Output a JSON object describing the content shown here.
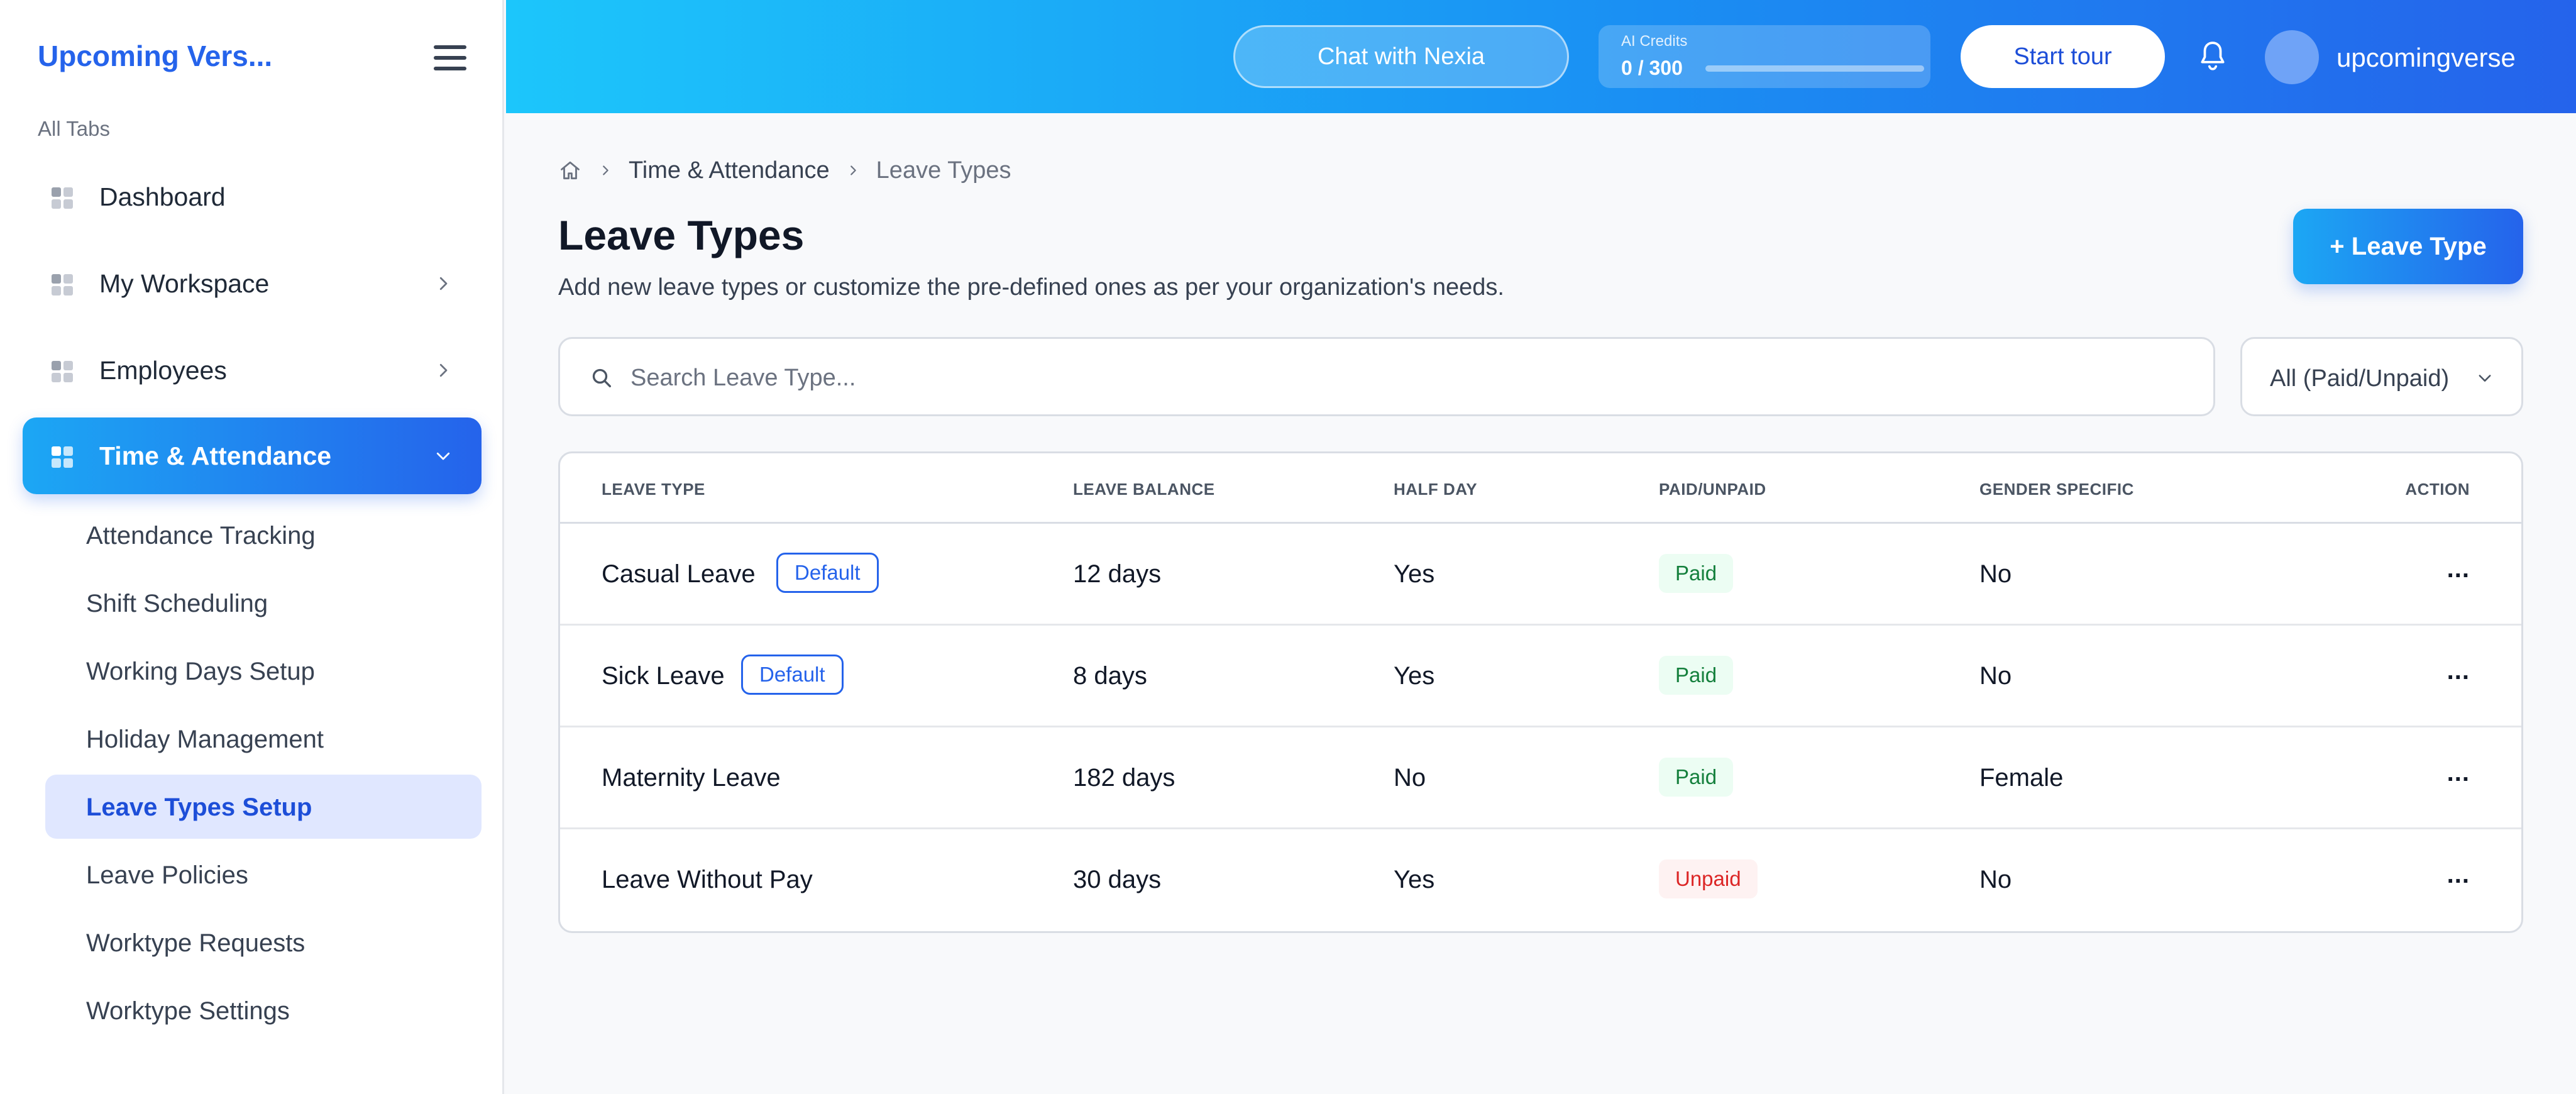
{
  "app": {
    "brand": "Upcoming Vers...",
    "menu_icon": "hamburger-icon"
  },
  "sidebar": {
    "section_label": "All Tabs",
    "nav": [
      {
        "label": "Dashboard",
        "icon": "grid-icon",
        "has_chevron": false
      },
      {
        "label": "My Workspace",
        "icon": "grid-icon",
        "has_chevron": true
      },
      {
        "label": "Employees",
        "icon": "grid-icon",
        "has_chevron": true
      },
      {
        "label": "Time & Attendance",
        "icon": "grid-icon",
        "active": true,
        "expanded": true
      }
    ],
    "sub_items": [
      {
        "label": "Attendance Tracking"
      },
      {
        "label": "Shift Scheduling"
      },
      {
        "label": "Working Days Setup"
      },
      {
        "label": "Holiday Management"
      },
      {
        "label": "Leave Types Setup",
        "active": true
      },
      {
        "label": "Leave Policies"
      },
      {
        "label": "Worktype Requests"
      },
      {
        "label": "Worktype Settings"
      }
    ]
  },
  "header": {
    "chat_label": "Chat with Nexia",
    "credits_label": "AI Credits",
    "credits_value": "0 / 300",
    "credits_fraction": 0,
    "tour_label": "Start tour",
    "bell_icon": "bell-icon",
    "username": "upcomingverse"
  },
  "breadcrumb": {
    "home_icon": "home-icon",
    "items": [
      "Time & Attendance",
      "Leave Types"
    ]
  },
  "page": {
    "title": "Leave Types",
    "subtitle": "Add new leave types or customize the pre-defined ones as per your organization's needs.",
    "add_button": "+ Leave Type"
  },
  "search": {
    "placeholder": "Search Leave Type...",
    "value": ""
  },
  "filter": {
    "selected": "All (Paid/Unpaid)"
  },
  "table": {
    "headers": [
      "LEAVE TYPE",
      "LEAVE BALANCE",
      "HALF DAY",
      "PAID/UNPAID",
      "GENDER SPECIFIC",
      "ACTION"
    ],
    "rows": [
      {
        "name": "Casual Leave",
        "badge": "Default",
        "balance": "12 days",
        "half_day": "Yes",
        "paid": "Paid",
        "gender": "No",
        "action": "..."
      },
      {
        "name": "Sick Leave",
        "badge": "Default",
        "balance": "8 days",
        "half_day": "Yes",
        "paid": "Paid",
        "gender": "No",
        "action": "..."
      },
      {
        "name": "Maternity Leave",
        "badge": "",
        "balance": "182 days",
        "half_day": "No",
        "paid": "Paid",
        "gender": "Female",
        "action": "..."
      },
      {
        "name": "Leave Without Pay",
        "badge": "",
        "balance": "30 days",
        "half_day": "Yes",
        "paid": "Unpaid",
        "gender": "No",
        "action": "..."
      }
    ]
  },
  "colors": {
    "accent": "#2563eb",
    "accent_light": "#1ca7f4",
    "paid": "#15803d",
    "unpaid": "#dc2626"
  }
}
